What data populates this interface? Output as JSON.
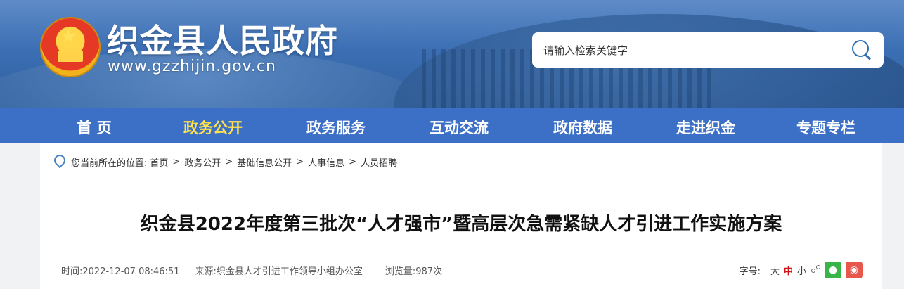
{
  "header": {
    "site_title": "织金县人民政府",
    "site_url": "www.gzzhijin.gov.cn",
    "search_placeholder": "请输入检索关键字"
  },
  "nav": {
    "items": [
      {
        "label": "首 页",
        "active": false
      },
      {
        "label": "政务公开",
        "active": true
      },
      {
        "label": "政务服务",
        "active": false
      },
      {
        "label": "互动交流",
        "active": false
      },
      {
        "label": "政府数据",
        "active": false
      },
      {
        "label": "走进织金",
        "active": false
      },
      {
        "label": "专题专栏",
        "active": false
      }
    ]
  },
  "breadcrumb": {
    "prefix": "您当前所在的位置:",
    "items": [
      "首页",
      "政务公开",
      "基础信息公开",
      "人事信息",
      "人员招聘"
    ]
  },
  "article": {
    "title": "织金县2022年度第三批次“人才强市”暨高层次急需紧缺人才引进工作实施方案",
    "time_label": "时间:",
    "time": "2022-12-07 08:46:51",
    "source_label": "来源:",
    "source": "织金县人才引进工作领导小组办公室",
    "views_label": "浏览量:",
    "views": "987次"
  },
  "tools": {
    "font_label": "字号:",
    "large": "大",
    "medium": "中",
    "small": "小"
  },
  "colors": {
    "nav_bg": "#3c70c6",
    "nav_active": "#ffe14d",
    "wechat": "#38b449",
    "weibo": "#e8574c"
  }
}
